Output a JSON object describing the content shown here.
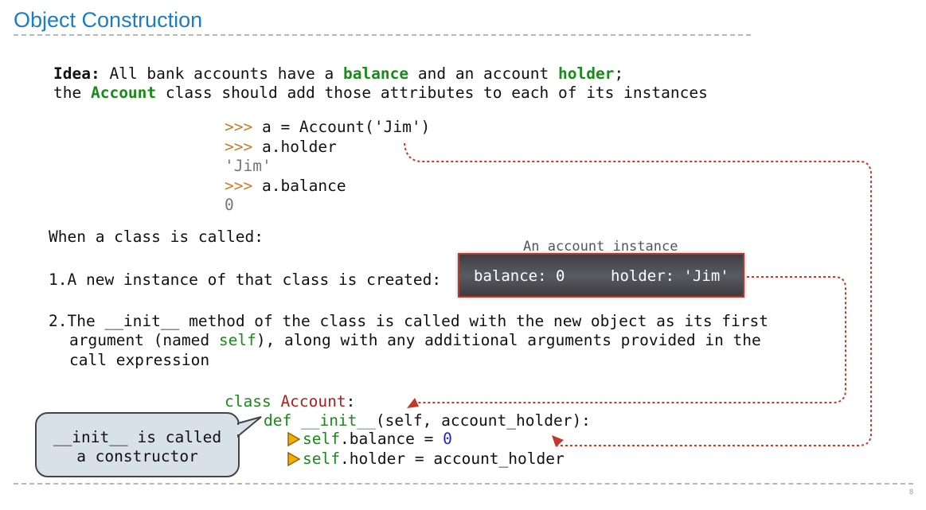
{
  "title": "Object Construction",
  "idea": {
    "label": "Idea:",
    "line1_a": " All bank accounts have a ",
    "balance": "balance",
    "line1_b": " and an account ",
    "holder": "holder",
    "line1_c": ";",
    "line2_a": "the ",
    "account": "Account",
    "line2_b": " class should add those attributes to each of its instances"
  },
  "repl": {
    "prompt": ">>>",
    "cmd1": " a = Account('Jim')",
    "cmd2": " a.holder",
    "out2": "'Jim'",
    "cmd3": " a.balance",
    "out3": "0"
  },
  "when_called": "When a class is called:",
  "step1": {
    "num": "1.",
    "text": "A new instance of that class is created:"
  },
  "step2": {
    "num": "2.",
    "line1_a": "The ",
    "init": "__init__",
    "line1_b": " method of the class is called with the new object as its first",
    "line2_a": "argument (named ",
    "self": "self",
    "line2_b": "), along with any additional arguments provided in the",
    "line3": "call expression"
  },
  "instance": {
    "label": "An account instance",
    "balance": "balance: 0",
    "holder": "holder: 'Jim'"
  },
  "code": {
    "class_kw": "class",
    "class_name": " Account",
    "class_colon": ":",
    "def_kw": "def",
    "def_name": " __init__",
    "def_rest": "(self, account_holder):",
    "self1": "self",
    "line2_rest": ".balance = ",
    "zero": "0",
    "self2": "self",
    "line3_rest": ".holder = account_holder"
  },
  "callout": {
    "line1": "__init__ is called",
    "line2": "a constructor"
  },
  "page_number": "8",
  "colors": {
    "title": "#1a7dc8",
    "keyword_green": "#1a8a1a",
    "class_red": "#b01e1e",
    "prompt_orange": "#c87d28",
    "arrow_red": "#c0392b",
    "number_blue": "#2323c8"
  }
}
